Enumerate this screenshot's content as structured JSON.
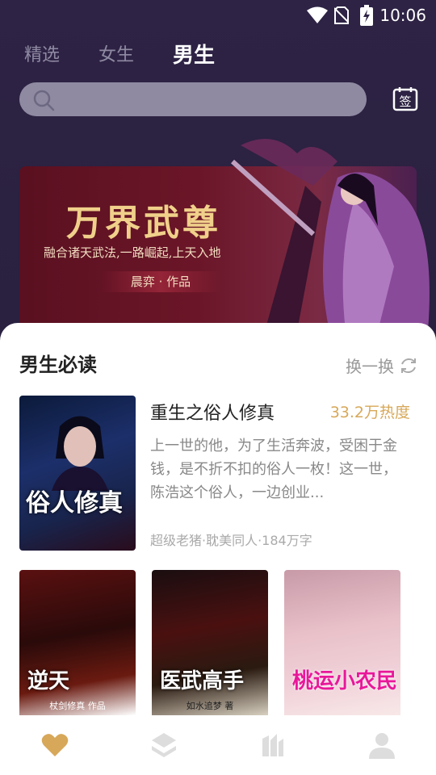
{
  "status": {
    "time": "10:06"
  },
  "tabs": [
    {
      "label": "精选"
    },
    {
      "label": "女生"
    },
    {
      "label": "男生"
    }
  ],
  "search": {
    "placeholder": ""
  },
  "checkin": {
    "label": "签"
  },
  "banner": {
    "title": "万界武尊",
    "subtitle": "融合诸天武法,一路崛起,上天入地",
    "author": "晨弈 · 作品"
  },
  "section": {
    "title": "男生必读",
    "refresh_label": "换一换"
  },
  "featured": {
    "name": "重生之俗人修真",
    "heat": "33.2万热度",
    "desc": "上一世的他，为了生活奔波，受困于金钱，是不折不扣的俗人一枚！这一世，陈浩这个俗人，一边创业...",
    "meta": "超级老猪·耽美同人·184万字",
    "cover_title": "俗人修真"
  },
  "books": [
    {
      "cover_title": "逆天",
      "cover_author": "杖剑修真 作品"
    },
    {
      "cover_title": "医武高手",
      "cover_author": "如水追梦 著"
    },
    {
      "cover_title": "桃运小农民",
      "cover_author": ""
    }
  ],
  "colors": {
    "accent": "#d7a85a",
    "header_bg": "#2e2345"
  },
  "nav_icons": [
    "heart-icon",
    "layers-icon",
    "library-icon",
    "profile-icon"
  ]
}
